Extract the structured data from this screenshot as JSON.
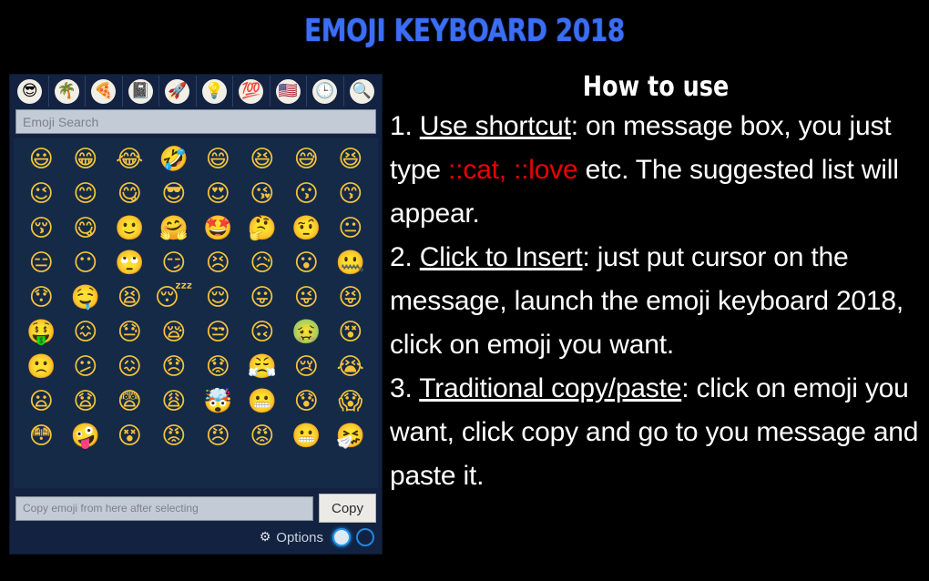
{
  "app_title": "EMOJI KEYBOARD 2018",
  "theme": {
    "title_color": "#3b6ef5",
    "panel_bg": "#122240",
    "grid_bg": "#152a47",
    "field_bg": "#c3ccd6",
    "accent_red": "#ee0000",
    "toggle_blue": "#2196f3",
    "page_bg": "#000000"
  },
  "keyboard": {
    "tabs": [
      {
        "name": "smileys-tab",
        "icon": "sunglasses-smiley-icon",
        "glyph": "😎"
      },
      {
        "name": "nature-tab",
        "icon": "palm-tree-icon",
        "glyph": "🌴"
      },
      {
        "name": "food-tab",
        "icon": "pizza-icon",
        "glyph": "🍕"
      },
      {
        "name": "activity-tab",
        "icon": "book-icon",
        "glyph": "📓"
      },
      {
        "name": "travel-tab",
        "icon": "rocket-icon",
        "glyph": "🚀"
      },
      {
        "name": "objects-tab",
        "icon": "lightbulb-icon",
        "glyph": "💡"
      },
      {
        "name": "symbols-tab",
        "icon": "hundred-points-icon",
        "glyph": "💯"
      },
      {
        "name": "flags-tab",
        "icon": "flag-icon",
        "glyph": "🇺🇸"
      },
      {
        "name": "recent-tab",
        "icon": "clock-icon",
        "glyph": "🕒"
      },
      {
        "name": "search-tab",
        "icon": "magnifier-icon",
        "glyph": "🔍"
      }
    ],
    "search": {
      "placeholder": "Emoji Search",
      "value": ""
    },
    "grid": {
      "columns": 8,
      "emojis": [
        "😃",
        "😁",
        "😂",
        "🤣",
        "😄",
        "😆",
        "😅",
        "😆",
        "😉",
        "😊",
        "😋",
        "😎",
        "😍",
        "😘",
        "😗",
        "😙",
        "😚",
        "😋",
        "🙂",
        "🤗",
        "🤩",
        "🤔",
        "🤨",
        "😐",
        "😑",
        "😶",
        "🙄",
        "😏",
        "😣",
        "😥",
        "😮",
        "🤐",
        "😯",
        "🤤",
        "😫",
        "😴",
        "😌",
        "😛",
        "😜",
        "😝",
        "🤑",
        "😖",
        "😓",
        "😪",
        "😒",
        "🙃",
        "🤢",
        "😵",
        "🙁",
        "😕",
        "😖",
        "😞",
        "😟",
        "😤",
        "😢",
        "😭",
        "😦",
        "😧",
        "😨",
        "😩",
        "🤯",
        "😬",
        "😰",
        "😱",
        "😳",
        "🤪",
        "😵",
        "😡",
        "😠",
        "😡",
        "😬",
        "🤧"
      ]
    },
    "copy_bar": {
      "output_placeholder": "Copy emoji from here after selecting",
      "output_value": "",
      "copy_label": "Copy"
    },
    "options_bar": {
      "gear_glyph": "⚙",
      "label": "Options",
      "toggle_left_state": "on",
      "toggle_right_state": "off"
    }
  },
  "howto": {
    "heading": "How to use",
    "steps": [
      {
        "number": "1.",
        "title": "Use shortcut",
        "text_before": ": on message box, you just type ",
        "highlight": "::cat, ::love",
        "text_after": " etc. The suggested list will appear."
      },
      {
        "number": "2.",
        "title": "Click to Insert",
        "text_before": ": just put cursor on the message, launch the emoji keyboard 2018, click on emoji you want.",
        "highlight": "",
        "text_after": ""
      },
      {
        "number": "3.",
        "title": "Traditional copy/paste",
        "text_before": ": click on emoji you want, click copy and go to you message and paste it.",
        "highlight": "",
        "text_after": ""
      }
    ]
  }
}
